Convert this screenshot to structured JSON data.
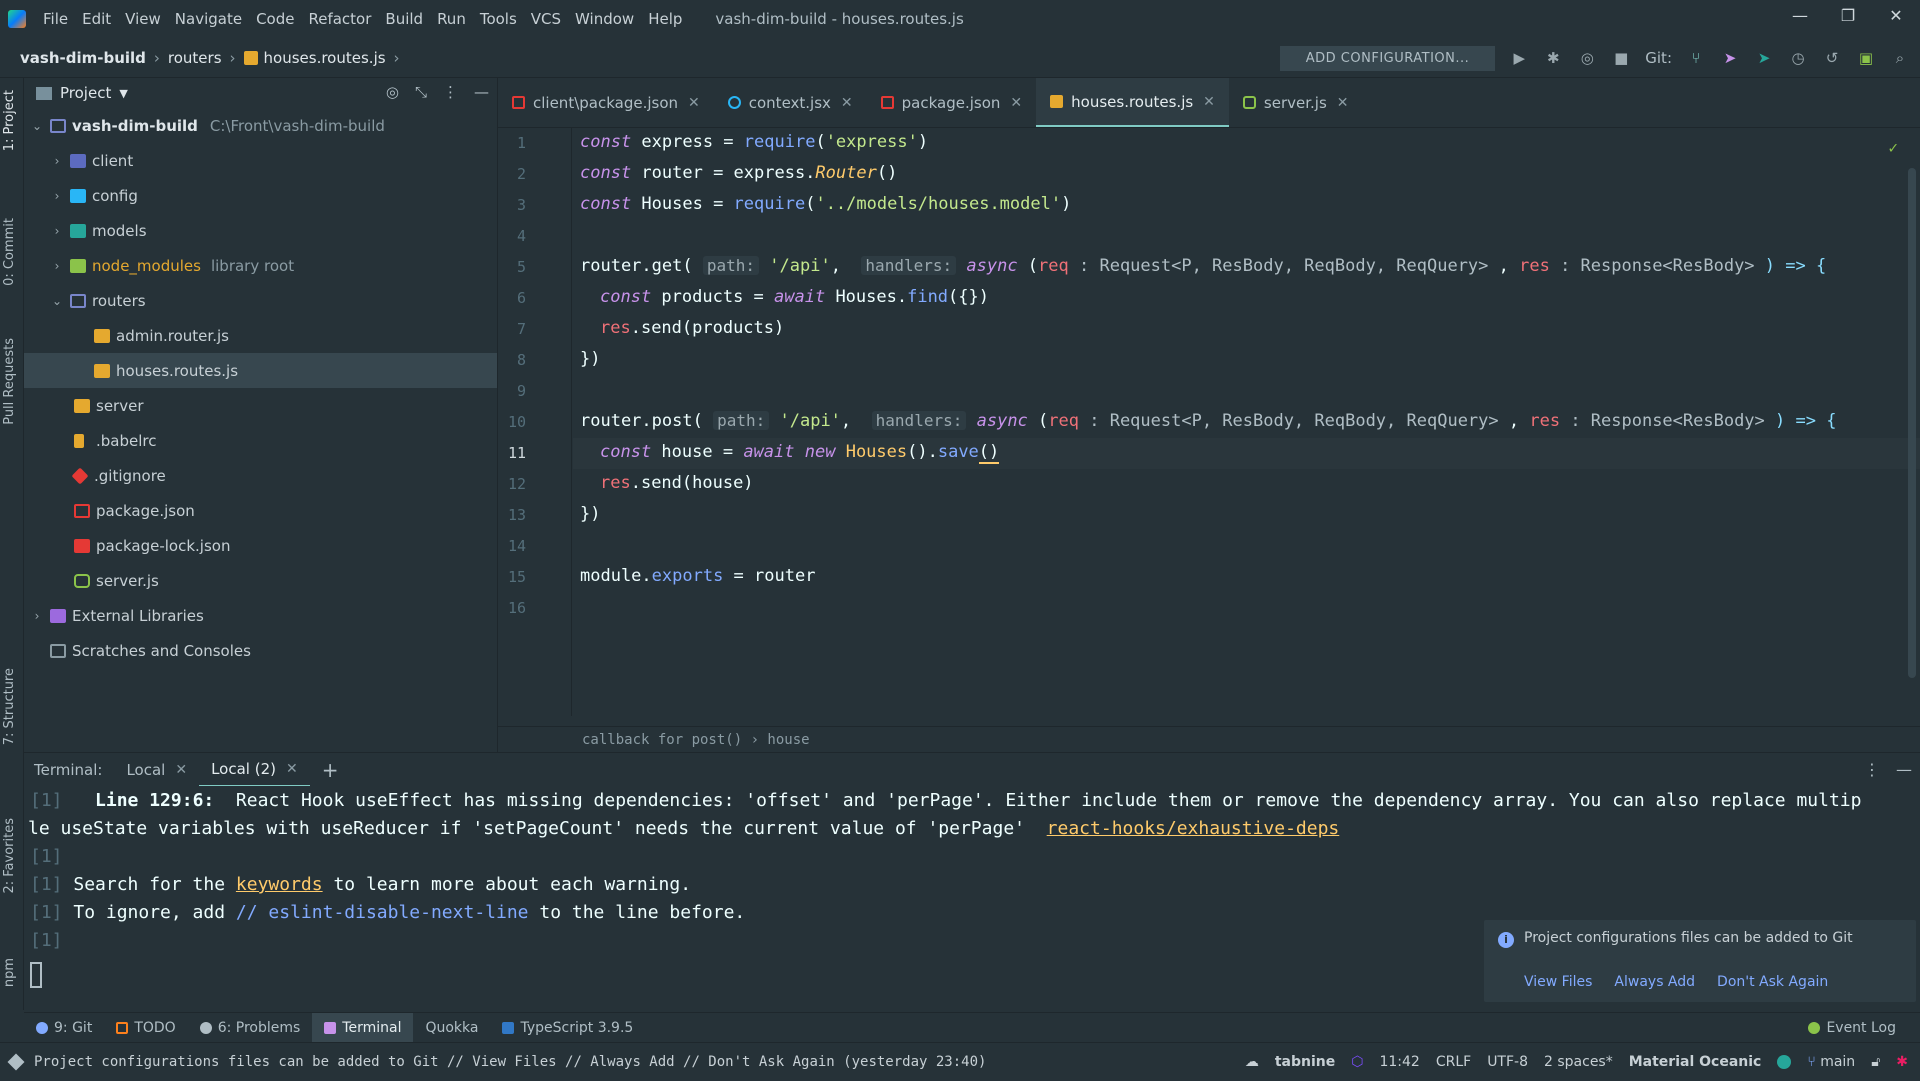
{
  "window": {
    "title": "vash-dim-build - houses.routes.js",
    "controls": [
      "—",
      "❐",
      "✕"
    ]
  },
  "menu": [
    "File",
    "Edit",
    "View",
    "Navigate",
    "Code",
    "Refactor",
    "Build",
    "Run",
    "Tools",
    "VCS",
    "Window",
    "Help"
  ],
  "breadcrumb": [
    "vash-dim-build",
    "routers",
    "houses.routes.js"
  ],
  "toolbar": {
    "add_configuration": "ADD CONFIGURATION...",
    "git_label": "Git:"
  },
  "left_strip": {
    "project": "1: Project",
    "commit": "0: Commit",
    "pull_requests": "Pull Requests",
    "structure": "7: Structure",
    "favorites": "2: Favorites",
    "npm": "npm"
  },
  "project_panel": {
    "title": "Project",
    "root": {
      "name": "vash-dim-build",
      "path": "C:\\Front\\vash-dim-build"
    },
    "items": [
      {
        "name": "client"
      },
      {
        "name": "config"
      },
      {
        "name": "models"
      },
      {
        "name": "node_modules",
        "note": "library root"
      },
      {
        "name": "routers"
      },
      {
        "name": "admin.router.js"
      },
      {
        "name": "houses.routes.js"
      },
      {
        "name": "server"
      },
      {
        "name": ".babelrc"
      },
      {
        "name": ".gitignore"
      },
      {
        "name": "package.json"
      },
      {
        "name": "package-lock.json"
      },
      {
        "name": "server.js"
      },
      {
        "name": "External Libraries"
      },
      {
        "name": "Scratches and Consoles"
      }
    ]
  },
  "editor_tabs": [
    {
      "label": "client\\package.json"
    },
    {
      "label": "context.jsx"
    },
    {
      "label": "package.json"
    },
    {
      "label": "houses.routes.js"
    },
    {
      "label": "server.js"
    }
  ],
  "line_numbers": [
    "1",
    "2",
    "3",
    "4",
    "5",
    "6",
    "7",
    "8",
    "9",
    "10",
    "11",
    "12",
    "13",
    "14",
    "15",
    "16"
  ],
  "code": {
    "l1": {
      "kw": "const",
      "a": " express = ",
      "fn": "require",
      "b": "(",
      "str": "'express'",
      "c": ")"
    },
    "l2": {
      "kw": "const",
      "a": " router = express.",
      "fn": "Router",
      "c": "()"
    },
    "l3": {
      "kw": "const",
      "a": " Houses = ",
      "fn": "require",
      "b": "(",
      "str": "'../models/houses.model'",
      "c": ")"
    },
    "l5": {
      "a": "router.get(",
      "h1": "path:",
      "str": "'/api'",
      "b": ",",
      "h2": "handlers:",
      "kw": "async",
      "c": " (",
      "p1": "req",
      "t1": " : Request<P, ResBody, ReqBody, ReqQuery>",
      "d": " , ",
      "p2": "res",
      "t2": " : Response<ResBody>",
      "e": " ) => {"
    },
    "l6": {
      "kw": "const",
      "a": " products = ",
      "kw2": "await",
      "b": " Houses.",
      "fn": "find",
      "c": "({})"
    },
    "l7": {
      "v": "res",
      "a": ".send(products)"
    },
    "l8": {
      "a": "})"
    },
    "l10": {
      "a": "router.post(",
      "h1": "path:",
      "str": "'/api'",
      "b": ",",
      "h2": "handlers:",
      "kw": "async",
      "c": " (",
      "p1": "req",
      "t1": " : Request<P, ResBody, ReqBody, ReqQuery>",
      "d": " , ",
      "p2": "res",
      "t2": " : Response<ResBody>",
      "e": " ) => {"
    },
    "l11": {
      "kw": "const",
      "a": " house = ",
      "kw2": "await",
      "kw3": "new",
      "cls": " Houses",
      "b": "().",
      "fn": "save",
      "c": "()"
    },
    "l12": {
      "v": "res",
      "a": ".send(house)"
    },
    "l13": {
      "a": "})"
    },
    "l15": {
      "a": "module.",
      "fn": "exports",
      "b": " = router"
    }
  },
  "editor_breadcrumb": "callback for post()  ›  house",
  "terminal": {
    "label": "Terminal:",
    "tabs": [
      "Local",
      "Local (2)"
    ],
    "add": "+",
    "lines": {
      "t1_prefix": "[1]",
      "t1_bold": "Line 129:6:",
      "t1_text": "  React Hook useEffect has missing dependencies: 'offset' and 'perPage'. Either include them or remove the dependency array. You can also replace multip",
      "t2_text": "le useState variables with useReducer if 'setPageCount' needs the current value of 'perPage'  ",
      "t2_link": "react-hooks/exhaustive-deps",
      "t3_prefix": "[1]",
      "t4_prefix": "[1]",
      "t4_a": " Search for the ",
      "t4_link": "keywords",
      "t4_b": " to learn more about each warning.",
      "t5_prefix": "[1]",
      "t5_a": " To ignore, add ",
      "t5_comment": "// eslint-disable-next-line",
      "t5_b": " to the line before.",
      "t6_prefix": "[1]"
    }
  },
  "notification": {
    "text": "Project configurations files can be added to Git",
    "actions": [
      "View Files",
      "Always Add",
      "Don't Ask Again"
    ]
  },
  "bottom_tools": [
    "9: Git",
    "TODO",
    "6: Problems",
    "Terminal",
    "Quokka",
    "TypeScript 3.9.5"
  ],
  "event_log": "Event Log",
  "status": {
    "message": "Project configurations files can be added to Git // View Files // Always Add // Don't Ask Again (yesterday 23:40)",
    "tabnine": "tabnine",
    "position": "11:42",
    "line_sep": "CRLF",
    "encoding": "UTF-8",
    "indent": "2 spaces*",
    "theme": "Material Oceanic",
    "branch": "main"
  },
  "colors": {
    "background": "#263238",
    "accent": "#80cbc4",
    "keyword": "#c792ea",
    "string": "#c3e88d",
    "function": "#82aaff",
    "variable": "#f07178"
  }
}
